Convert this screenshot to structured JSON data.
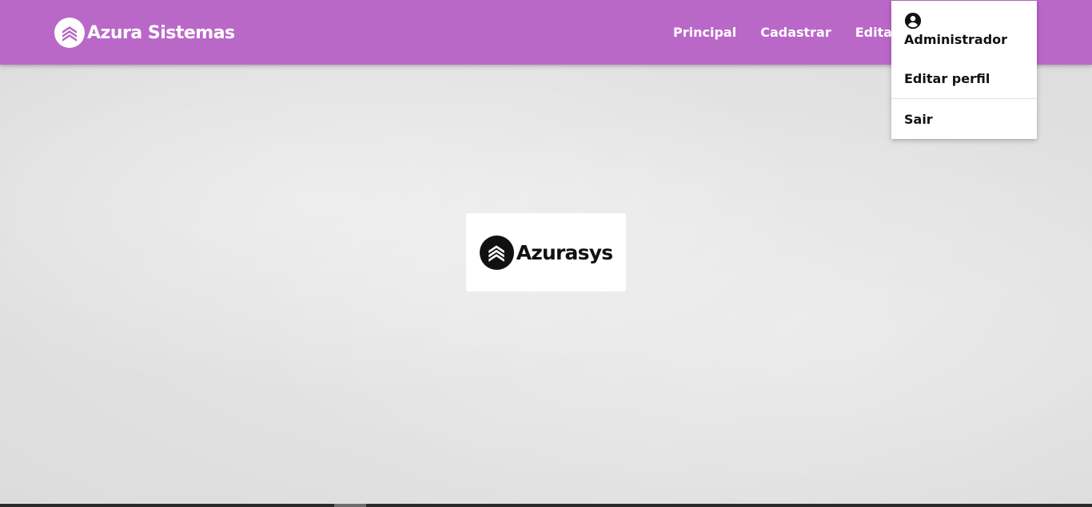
{
  "brand": {
    "name": "Azura Sistemas",
    "logo_icon": "chevrons-up-icon"
  },
  "nav": {
    "items": [
      {
        "label": "Principal"
      },
      {
        "label": "Cadastrar"
      },
      {
        "label": "Editar"
      }
    ],
    "separator": "|"
  },
  "user_menu": {
    "user_icon": "account-circle-icon",
    "user_name": "Administrador",
    "items": [
      {
        "label": "Editar perfil"
      },
      {
        "label": "Sair"
      }
    ]
  },
  "center_logo": {
    "text": "Azurasys",
    "icon": "chevrons-up-icon"
  },
  "colors": {
    "navbar": "#ba68c8",
    "background": "#e2e2e2",
    "text_dark": "#111111"
  }
}
